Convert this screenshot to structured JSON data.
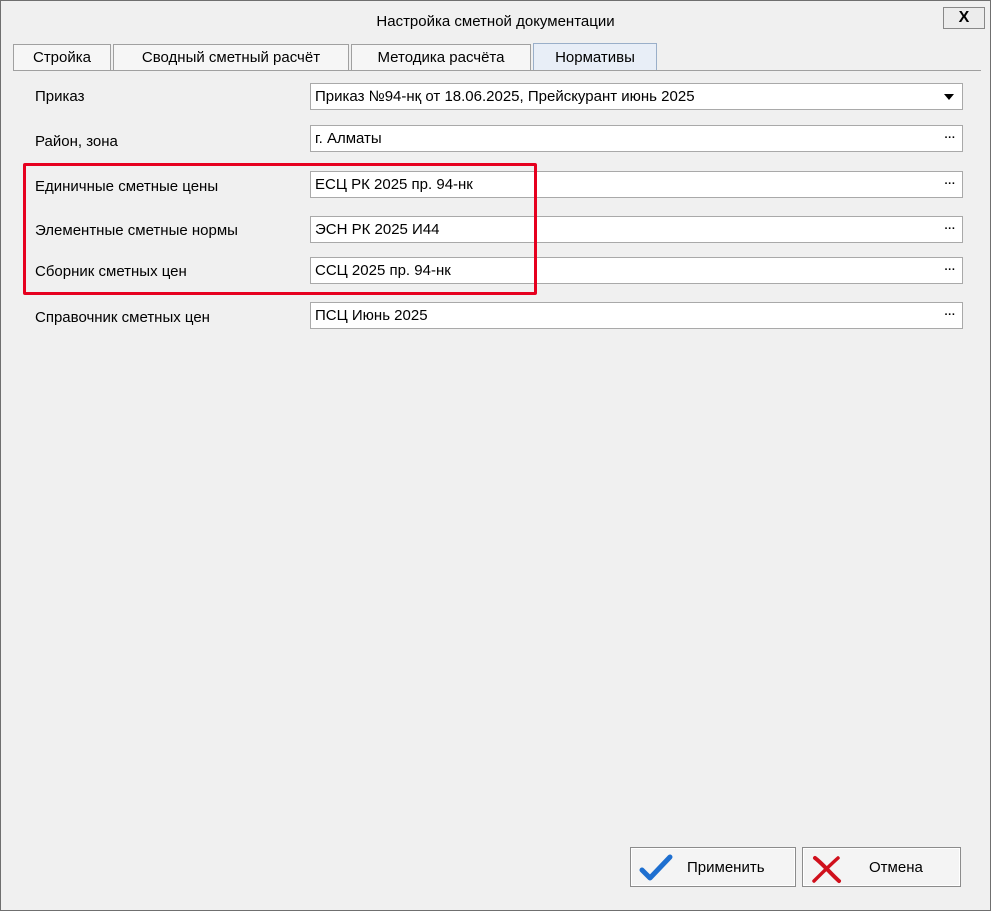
{
  "window": {
    "title": "Настройка сметной документации",
    "close_label": "X"
  },
  "tabs": [
    {
      "label": "Стройка"
    },
    {
      "label": "Сводный сметный расчёт"
    },
    {
      "label": "Методика расчёта"
    },
    {
      "label": "Нормативы"
    }
  ],
  "active_tab": "Нормативы",
  "fields": {
    "prikaz": {
      "label": "Приказ",
      "value": "Приказ №94-нқ от 18.06.2025, Прейскурант июнь 2025"
    },
    "rayon": {
      "label": "Район, зона",
      "value": "г. Алматы"
    },
    "esc": {
      "label": "Единичные сметные цены",
      "value": "ЕСЦ РК 2025 пр. 94-нк"
    },
    "esn": {
      "label": "Элементные сметные нормы",
      "value": "ЭСН РК 2025 И44"
    },
    "ssc": {
      "label": "Сборник сметных цен",
      "value": "ССЦ 2025 пр. 94-нк"
    },
    "psc": {
      "label": "Справочник сметных цен",
      "value": "ПСЦ Июнь 2025"
    }
  },
  "ellipsis": "···",
  "buttons": {
    "apply_label": "Применить",
    "cancel_label": "Отмена"
  },
  "colors": {
    "highlight": "#e6001f",
    "apply_icon": "#1e6fd0",
    "cancel_icon": "#d0101c"
  }
}
